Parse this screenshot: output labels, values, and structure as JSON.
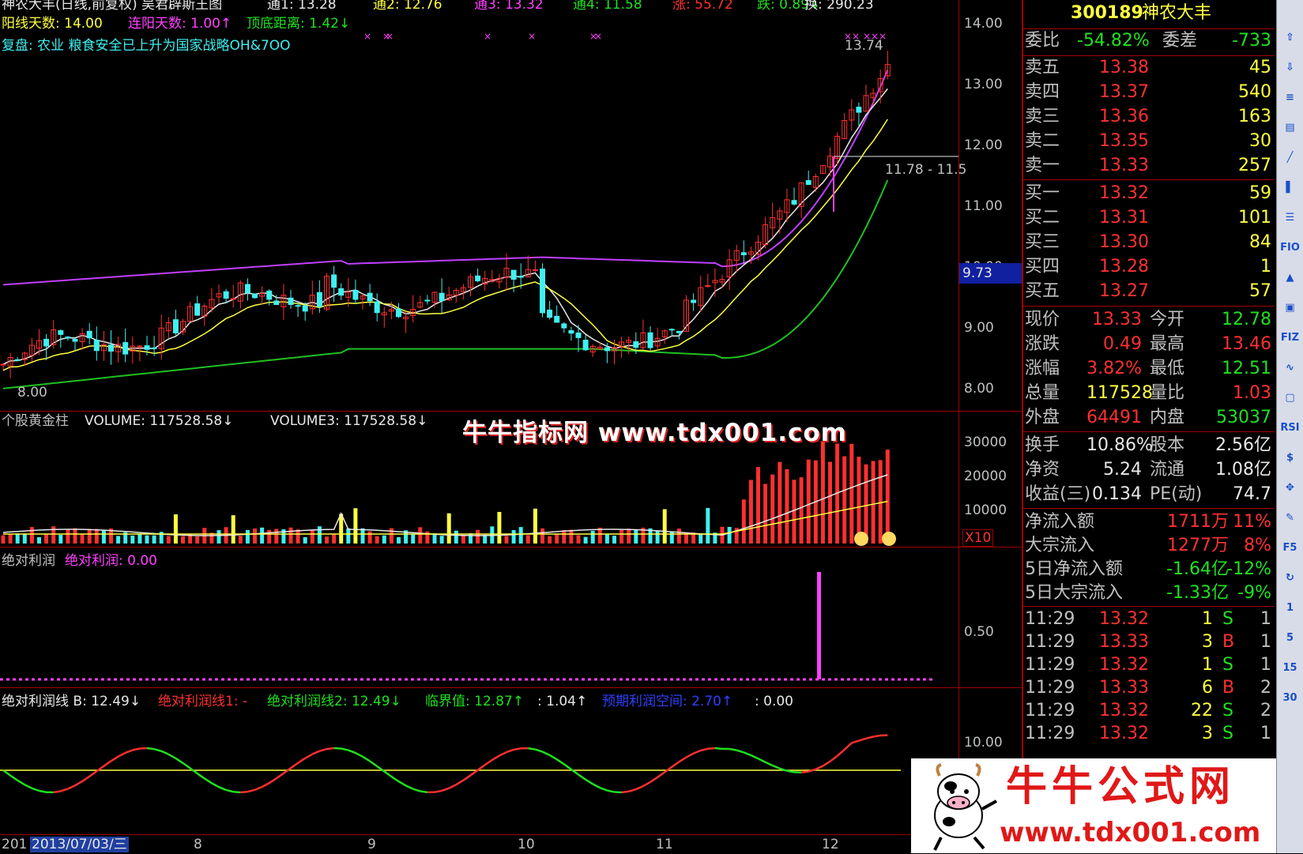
{
  "header": {
    "title_line": "神农大丰(日线,前复权) 吴君辟斯王图",
    "items": [
      {
        "text": "通1: 13.28",
        "color": "#e8e8e8"
      },
      {
        "text": "通2: 12.76",
        "color": "#ffff40"
      },
      {
        "text": "通3: 13.32",
        "color": "#ff40ff"
      },
      {
        "text": "通4: 11.58",
        "color": "#20e020"
      },
      {
        "text": "涨: 55.72",
        "color": "#ff3030"
      },
      {
        "text": "跌: 0.89↓",
        "color": "#20e020"
      },
      {
        "text": "换: 290.23",
        "color": "#e8e8e8"
      }
    ],
    "line2": [
      {
        "text": "阳线天数: 14.00",
        "color": "#ffff40"
      },
      {
        "text": "连阳天数: 1.00↑",
        "color": "#ff40ff"
      },
      {
        "text": "顶底距离: 1.42↓",
        "color": "#20e020"
      }
    ],
    "line3": "复盘: 农业 粮食安全已上升为国家战略OH&7OO"
  },
  "main_chart": {
    "high_label": "13.74",
    "low_label": "8.00",
    "range_label": "11.78 - 11.5",
    "price_marker": "9.73",
    "axis_ticks": [
      "14.00",
      "13.00",
      "12.00",
      "11.00",
      "10.00",
      "9.00",
      "8.00"
    ],
    "colors": {
      "up": "#ff3030",
      "down": "#40f0f0",
      "ma1": "#e8e8e8",
      "ma2": "#ffff40",
      "ma3": "#c040ff",
      "ma4": "#20c020"
    }
  },
  "volume_panel": {
    "labels": [
      {
        "text": "个股黄金柱",
        "color": "#c0c0c0"
      },
      {
        "text": "VOLUME: 117528.58↓",
        "color": "#e8e8e8"
      },
      {
        "text": "VOLUME3: 117528.58↓",
        "color": "#e8e8e8"
      }
    ],
    "axis_ticks": [
      "30000",
      "20000",
      "10000"
    ],
    "unit_label": "X10",
    "watermark": "牛牛指标网 www.tdx001.com"
  },
  "profit_panel": {
    "labels": [
      {
        "text": "绝对利润",
        "color": "#c0c0c0"
      },
      {
        "text": "绝对利润: 0.00",
        "color": "#ff40ff"
      }
    ],
    "axis_ticks": [
      "0.50"
    ]
  },
  "line_panel": {
    "labels": [
      {
        "text": "绝对利润线 B: 12.49↓",
        "color": "#e8e8e8"
      },
      {
        "text": "绝对利润线1: -",
        "color": "#ff3030"
      },
      {
        "text": "绝对利润线2: 12.49↓",
        "color": "#20e020"
      },
      {
        "text": "临界值: 12.87↑",
        "color": "#20e020"
      },
      {
        "text": ": 1.04↑",
        "color": "#e8e8e8"
      },
      {
        "text": "预期利润空间: 2.70↑",
        "color": "#3040ff"
      },
      {
        "text": ": 0.00",
        "color": "#e8e8e8"
      }
    ],
    "axis_ticks": [
      "10.00"
    ]
  },
  "date_axis": {
    "start": "201",
    "current": "2013/07/03/三",
    "months": [
      "8",
      "9",
      "10",
      "11",
      "12"
    ]
  },
  "quote": {
    "stock_code": "300189",
    "stock_name": "神农大丰",
    "wei_bi": {
      "label": "委比",
      "value": "-54.82%",
      "label2": "委差",
      "value2": "-733"
    },
    "sell": [
      {
        "label": "卖五",
        "price": "13.38",
        "vol": "45"
      },
      {
        "label": "卖四",
        "price": "13.37",
        "vol": "540"
      },
      {
        "label": "卖三",
        "price": "13.36",
        "vol": "163"
      },
      {
        "label": "卖二",
        "price": "13.35",
        "vol": "30"
      },
      {
        "label": "卖一",
        "price": "13.33",
        "vol": "257"
      }
    ],
    "buy": [
      {
        "label": "买一",
        "price": "13.32",
        "vol": "59"
      },
      {
        "label": "买二",
        "price": "13.31",
        "vol": "101"
      },
      {
        "label": "买三",
        "price": "13.30",
        "vol": "84"
      },
      {
        "label": "买四",
        "price": "13.28",
        "vol": "1"
      },
      {
        "label": "买五",
        "price": "13.27",
        "vol": "57"
      }
    ],
    "stats": [
      {
        "l1": "现价",
        "v1": "13.33",
        "c1": "#ff3030",
        "l2": "今开",
        "v2": "12.78",
        "c2": "#20e020"
      },
      {
        "l1": "涨跌",
        "v1": "0.49",
        "c1": "#ff3030",
        "l2": "最高",
        "v2": "13.46",
        "c2": "#ff3030"
      },
      {
        "l1": "涨幅",
        "v1": "3.82%",
        "c1": "#ff3030",
        "l2": "最低",
        "v2": "12.51",
        "c2": "#20e020"
      },
      {
        "l1": "总量",
        "v1": "117528",
        "c1": "#ffff40",
        "l2": "量比",
        "v2": "1.03",
        "c2": "#ff3030"
      },
      {
        "l1": "外盘",
        "v1": "64491",
        "c1": "#ff3030",
        "l2": "内盘",
        "v2": "53037",
        "c2": "#20e020"
      }
    ],
    "stats2": [
      {
        "l1": "换手",
        "v1": "10.86%",
        "c1": "#e8e8e8",
        "l2": "股本",
        "v2": "2.56亿",
        "c2": "#e8e8e8"
      },
      {
        "l1": "净资",
        "v1": "5.24",
        "c1": "#e8e8e8",
        "l2": "流通",
        "v2": "1.08亿",
        "c2": "#e8e8e8"
      },
      {
        "l1": "收益(三)",
        "v1": "0.134",
        "c1": "#e8e8e8",
        "l2": "PE(动)",
        "v2": "74.7",
        "c2": "#e8e8e8"
      }
    ],
    "flows": [
      {
        "label": "净流入额",
        "value": "1711万",
        "pct": "11%",
        "color": "#ff3030"
      },
      {
        "label": "大宗流入",
        "value": "1277万",
        "pct": "8%",
        "color": "#ff3030"
      },
      {
        "label": "5日净流入额",
        "value": "-1.64亿",
        "pct": "-12%",
        "color": "#20e020"
      },
      {
        "label": "5日大宗流入",
        "value": "-1.33亿",
        "pct": "-9%",
        "color": "#20e020"
      }
    ],
    "ticks": [
      {
        "time": "11:29",
        "price": "13.32",
        "vol": "1",
        "bs": "S",
        "n": "1"
      },
      {
        "time": "11:29",
        "price": "13.33",
        "vol": "3",
        "bs": "B",
        "n": "1"
      },
      {
        "time": "11:29",
        "price": "13.32",
        "vol": "1",
        "bs": "S",
        "n": "1"
      },
      {
        "time": "11:29",
        "price": "13.33",
        "vol": "6",
        "bs": "B",
        "n": "2"
      },
      {
        "time": "11:29",
        "price": "13.32",
        "vol": "22",
        "bs": "S",
        "n": "2"
      },
      {
        "time": "11:29",
        "price": "13.32",
        "vol": "3",
        "bs": "S",
        "n": "1"
      }
    ]
  },
  "toolbar": [
    "⇧",
    "⇩",
    "≡",
    "▤",
    "╱",
    "▌",
    "☰",
    "FIO",
    "▲",
    "▣",
    "FIZ",
    "∿",
    "▢",
    "RSI",
    "$",
    "✥",
    "✎",
    "F5",
    "↻",
    "1",
    "5",
    "15",
    "30"
  ],
  "logo": {
    "title": "牛牛公式网",
    "url": "www.tdx001.com"
  }
}
